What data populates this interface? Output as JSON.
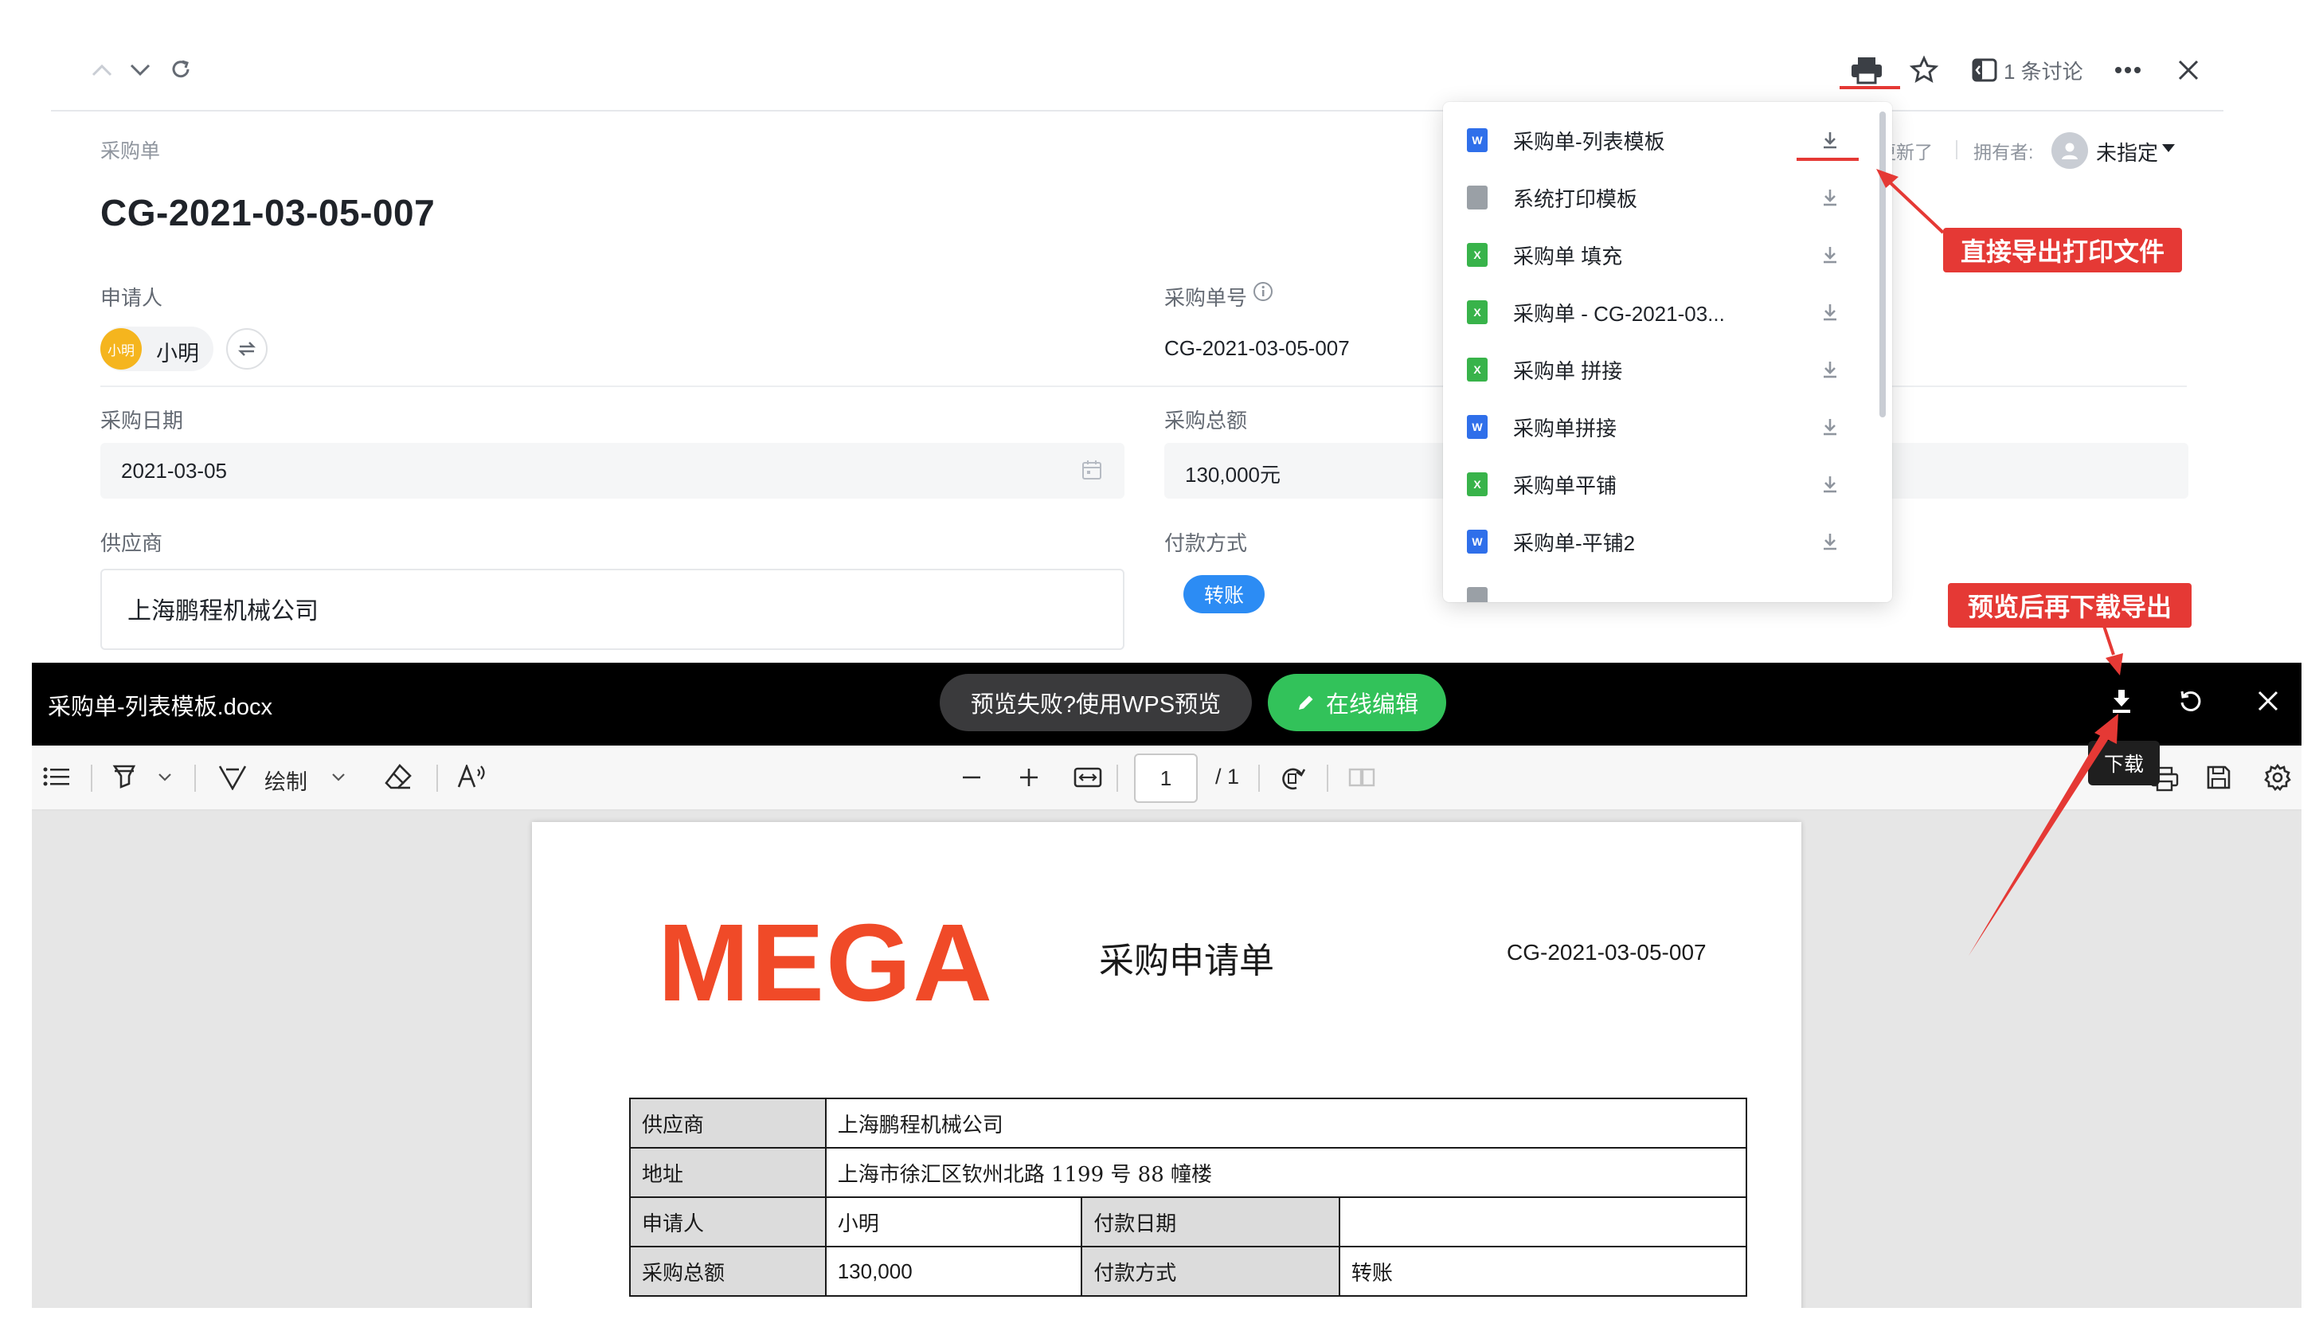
{
  "topbar": {
    "discussion_label": "1 条讨论"
  },
  "record": {
    "breadcrumb": "采购单",
    "title": "CG-2021-03-05-007",
    "applicant_label": "申请人",
    "applicant_avatar_text": "小明",
    "applicant_name": "小明",
    "order_no_label": "采购单号",
    "order_no_value": "CG-2021-03-05-007",
    "date_label": "采购日期",
    "date_value": "2021-03-05",
    "total_label": "采购总额",
    "total_value": "130,000元",
    "supplier_label": "供应商",
    "supplier_value": "上海鹏程机械公司",
    "payment_label": "付款方式",
    "payment_value": "转账",
    "updated_fragment": "更新了",
    "owner_label": "拥有者:",
    "owner_value": "未指定"
  },
  "dropdown": {
    "items": [
      {
        "label": "采购单-列表模板",
        "type": "W",
        "color": "#2f6fea"
      },
      {
        "label": "系统打印模板",
        "type": "",
        "color": "#9aa0a6"
      },
      {
        "label": "采购单 填充",
        "type": "X",
        "color": "#38b34a"
      },
      {
        "label": "采购单 - CG-2021-03...",
        "type": "X",
        "color": "#38b34a"
      },
      {
        "label": "采购单 拼接",
        "type": "X",
        "color": "#38b34a"
      },
      {
        "label": "采购单拼接",
        "type": "W",
        "color": "#2f6fea"
      },
      {
        "label": "采购单平铺",
        "type": "X",
        "color": "#38b34a"
      },
      {
        "label": "采购单-平铺2",
        "type": "W",
        "color": "#2f6fea"
      }
    ]
  },
  "preview": {
    "file_name": "采购单-列表模板.docx",
    "wps_button": "预览失败?使用WPS预览",
    "edit_button": "在线编辑",
    "download_tooltip": "下载"
  },
  "toolbar": {
    "draw_label": "绘制",
    "page_input": "1",
    "page_total": "/ 1"
  },
  "document": {
    "logo_text": "MEGA",
    "title": "采购申请单",
    "number": "CG-2021-03-05-007",
    "rows": [
      {
        "label": "供应商",
        "value": "上海鹏程机械公司"
      },
      {
        "label": "地址",
        "value": "上海市徐汇区钦州北路 1199 号 88 幢楼"
      },
      {
        "label": "申请人",
        "value": "小明",
        "label2": "付款日期",
        "value2": ""
      },
      {
        "label": "采购总额",
        "value": "130,000",
        "label2": "付款方式",
        "value2": "转账"
      }
    ]
  },
  "annotations": {
    "export_direct": "直接导出打印文件",
    "download_after_preview": "预览后再下载导出"
  },
  "colors": {
    "accent_red": "#e53935",
    "edit_green": "#32c25a",
    "tag_blue": "#2c8cf4",
    "mega_orange": "#f04a28"
  }
}
